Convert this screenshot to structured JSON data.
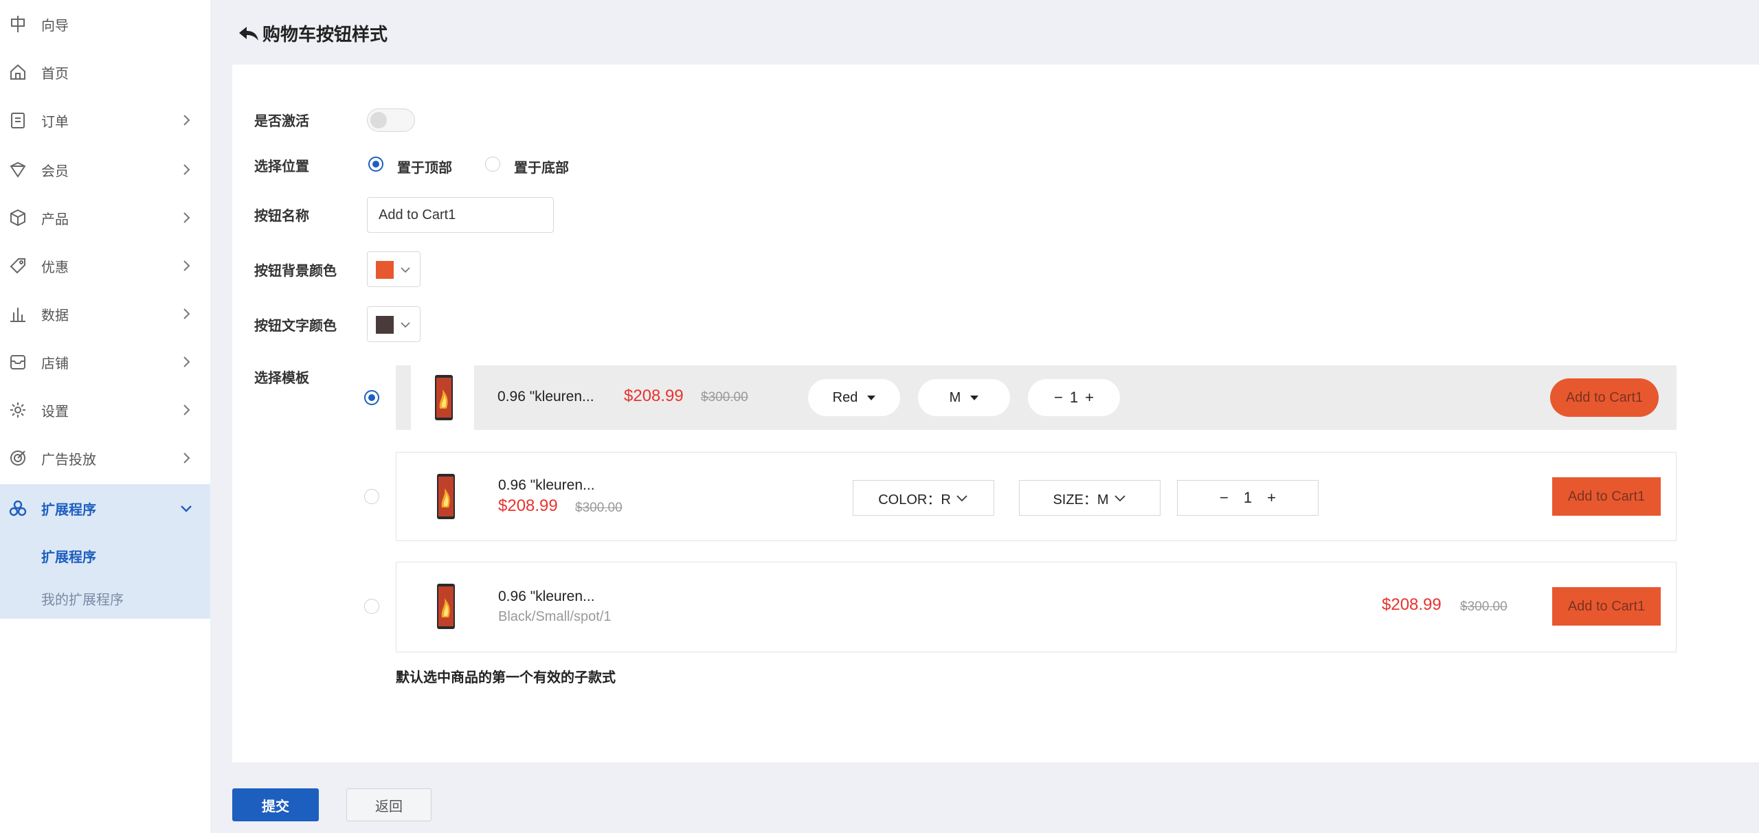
{
  "sidebar": {
    "items": [
      {
        "label": "向导",
        "icon": "guide-icon",
        "has_chevron": false
      },
      {
        "label": "首页",
        "icon": "home-icon",
        "has_chevron": false
      },
      {
        "label": "订单",
        "icon": "order-icon",
        "has_chevron": true
      },
      {
        "label": "会员",
        "icon": "member-icon",
        "has_chevron": true
      },
      {
        "label": "产品",
        "icon": "product-icon",
        "has_chevron": true
      },
      {
        "label": "优惠",
        "icon": "coupon-icon",
        "has_chevron": true
      },
      {
        "label": "数据",
        "icon": "chart-icon",
        "has_chevron": true
      },
      {
        "label": "店铺",
        "icon": "store-icon",
        "has_chevron": true
      },
      {
        "label": "设置",
        "icon": "gear-icon",
        "has_chevron": true
      },
      {
        "label": "广告投放",
        "icon": "ads-icon",
        "has_chevron": true
      },
      {
        "label": "扩展程序",
        "icon": "extensions-icon",
        "has_chevron": true,
        "active": true
      }
    ],
    "submenu": {
      "current": "扩展程序",
      "other": "我的扩展程序"
    }
  },
  "header": {
    "title": "购物车按钮样式"
  },
  "form": {
    "active_label": "是否激活",
    "active": false,
    "position_label": "选择位置",
    "position_top": "置于顶部",
    "position_bottom": "置于底部",
    "position_selected": "top",
    "name_label": "按钮名称",
    "name_value": "Add to Cart1",
    "bg_color_label": "按钮背景颜色",
    "bg_color": "#e8582f",
    "text_color_label": "按钮文字颜色",
    "text_color": "#4a3b3b",
    "template_label": "选择模板",
    "template_selected": 1,
    "hint": "默认选中商品的第一个有效的子款式"
  },
  "product": {
    "title": "0.96 \"kleuren...",
    "price": "$208.99",
    "old_price": "$300.00",
    "variant": "Black/Small/spot/1"
  },
  "template1": {
    "color_value": "Red",
    "size_value": "M",
    "qty": "1",
    "minus": "−",
    "plus": "+",
    "button": "Add to Cart1"
  },
  "template2": {
    "color_select": "COLOR：R",
    "size_select": "SIZE：M",
    "qty": "1",
    "minus": "−",
    "plus": "+",
    "button": "Add to Cart1"
  },
  "template3": {
    "button": "Add to Cart1"
  },
  "footer": {
    "submit": "提交",
    "back": "返回"
  },
  "colors": {
    "primary": "#1d5fbf",
    "price": "#e8332e",
    "cart_button": "#e8582f"
  }
}
